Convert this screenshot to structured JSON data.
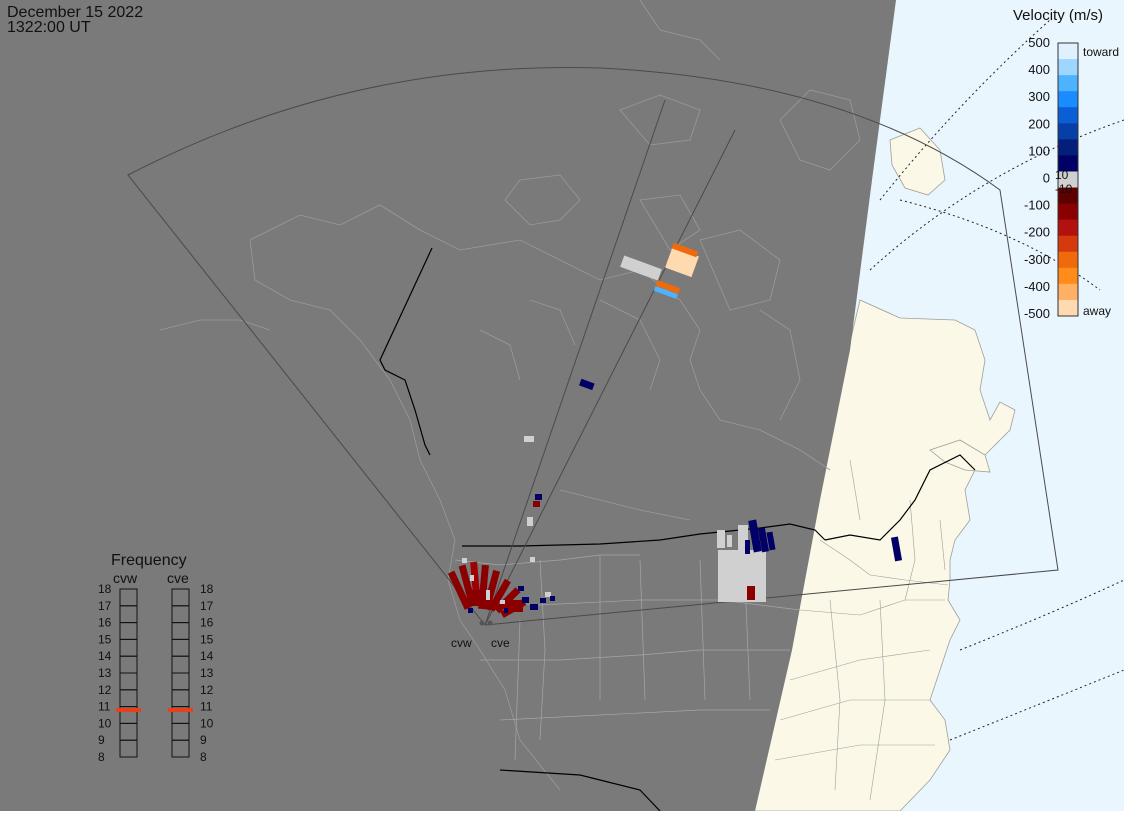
{
  "header": {
    "date": "December 15 2022",
    "time": "1322:00 UT"
  },
  "velocity_legend": {
    "title": "Velocity (m/s)",
    "ticks": [
      "500",
      "400",
      "300",
      "200",
      "100",
      "0",
      "-100",
      "-200",
      "-300",
      "-400",
      "-500"
    ],
    "threshold_pos": "10",
    "threshold_neg": "-10",
    "label_toward": "toward",
    "label_away": "away",
    "colors": [
      "#dff1ff",
      "#9fd6ff",
      "#4db3ff",
      "#1a8cff",
      "#0a5fd6",
      "#073fa8",
      "#041f7a",
      "#000066",
      "#d0d0d0",
      "#5c0000",
      "#8a0000",
      "#b31010",
      "#d43a0d",
      "#ef6a0a",
      "#ff8c1a",
      "#ffb066",
      "#ffd9b0"
    ]
  },
  "frequency_panel": {
    "title": "Frequency",
    "radars": [
      "cvw",
      "cve"
    ],
    "levels": [
      "18",
      "17",
      "16",
      "15",
      "14",
      "13",
      "12",
      "11",
      "10",
      "9",
      "8"
    ],
    "cvw_frequency_mhz": 10.8,
    "cve_frequency_mhz": 10.8,
    "marker_color": "#e8401a"
  },
  "radar_sites": {
    "cvw_label": "cvw",
    "cve_label": "cve"
  },
  "colors": {
    "night": "#7a7a7a",
    "land_day": "#fbf8e7",
    "ocean_day": "#eaf6fd",
    "coast_line": "#9e9e9e",
    "border_line": "#000000"
  }
}
